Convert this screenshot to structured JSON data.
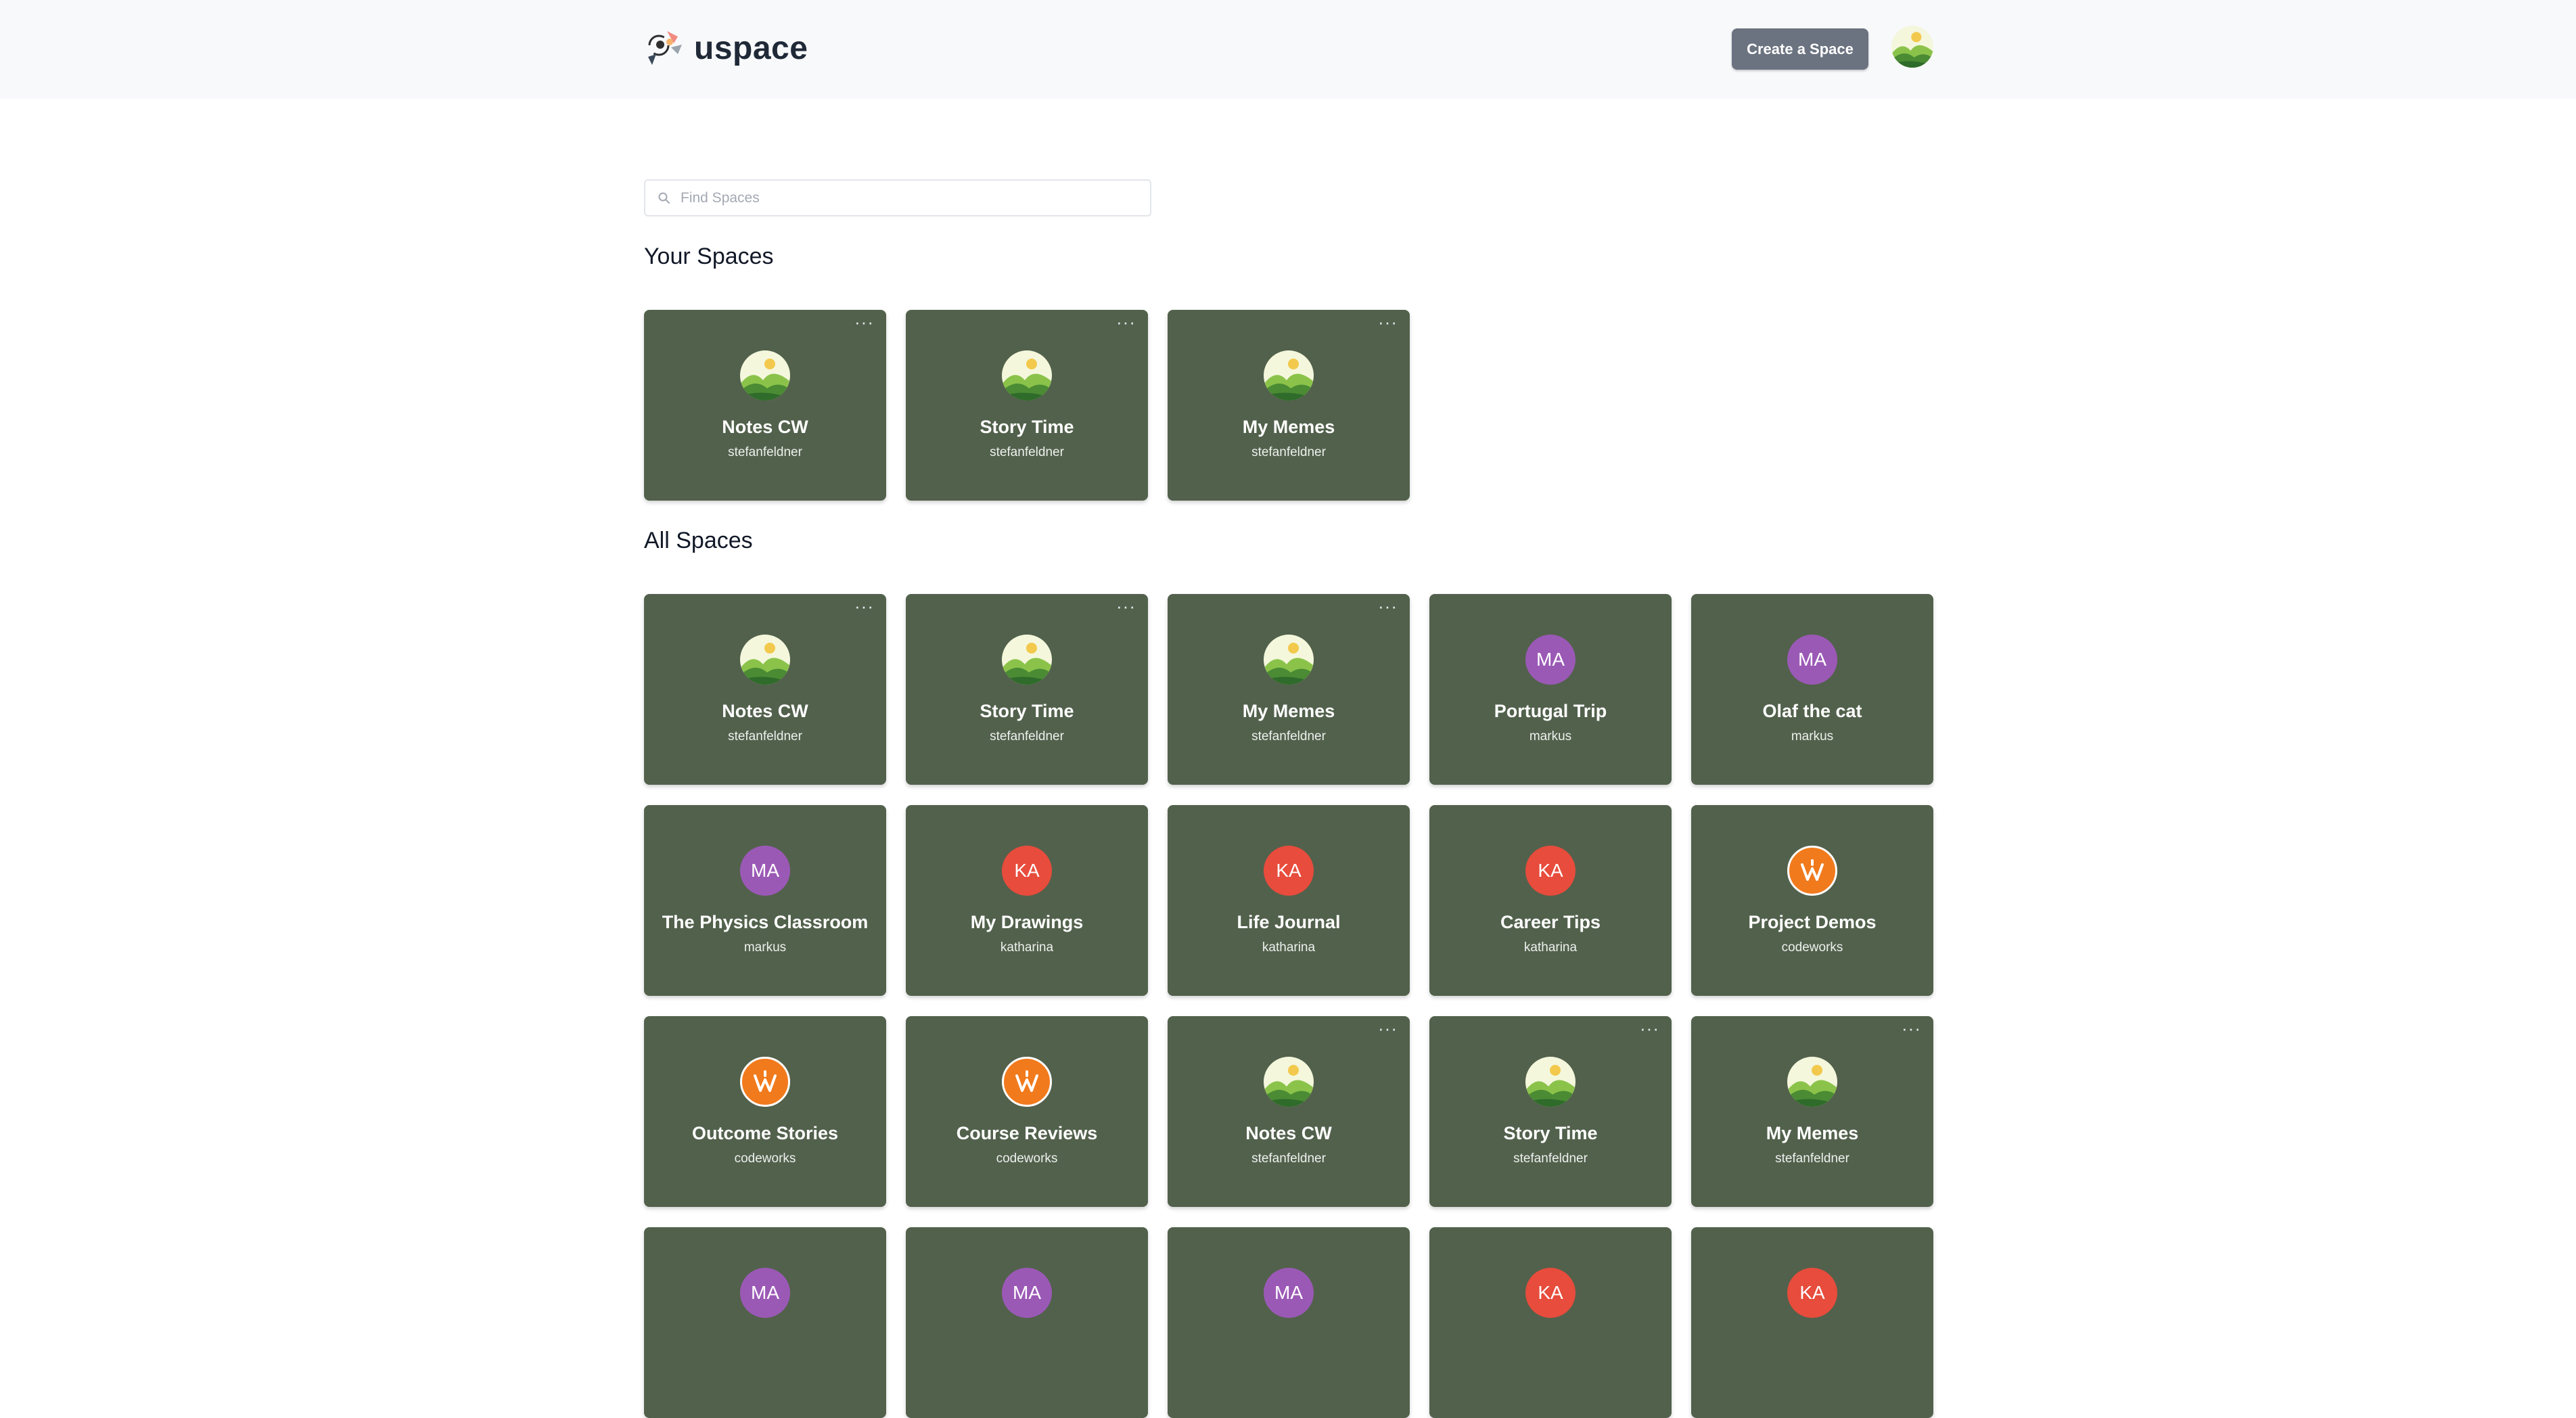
{
  "header": {
    "brand": "uspace",
    "create_label": "Create a Space"
  },
  "search": {
    "placeholder": "Find Spaces",
    "value": ""
  },
  "your_spaces": {
    "title": "Your Spaces",
    "cards": [
      {
        "title": "Notes CW",
        "owner": "stefanfeldner",
        "avatar": "landscape",
        "menu": "···"
      },
      {
        "title": "Story Time",
        "owner": "stefanfeldner",
        "avatar": "landscape",
        "menu": "···"
      },
      {
        "title": "My Memes",
        "owner": "stefanfeldner",
        "avatar": "landscape",
        "menu": "···"
      }
    ]
  },
  "all_spaces": {
    "title": "All Spaces",
    "cards": [
      {
        "title": "Notes CW",
        "owner": "stefanfeldner",
        "avatar": "landscape",
        "menu": "···"
      },
      {
        "title": "Story Time",
        "owner": "stefanfeldner",
        "avatar": "landscape",
        "menu": "···"
      },
      {
        "title": "My Memes",
        "owner": "stefanfeldner",
        "avatar": "landscape",
        "menu": "···"
      },
      {
        "title": "Portugal Trip",
        "owner": "markus",
        "avatar": "initials",
        "initials": "MA"
      },
      {
        "title": "Olaf the cat",
        "owner": "markus",
        "avatar": "initials",
        "initials": "MA"
      },
      {
        "title": "The Physics Classroom",
        "owner": "markus",
        "avatar": "initials",
        "initials": "MA"
      },
      {
        "title": "My Drawings",
        "owner": "katharina",
        "avatar": "initials",
        "initials": "KA"
      },
      {
        "title": "Life Journal",
        "owner": "katharina",
        "avatar": "initials",
        "initials": "KA"
      },
      {
        "title": "Career Tips",
        "owner": "katharina",
        "avatar": "initials",
        "initials": "KA"
      },
      {
        "title": "Project Demos",
        "owner": "codeworks",
        "avatar": "codeworks-logo"
      },
      {
        "title": "Outcome Stories",
        "owner": "codeworks",
        "avatar": "codeworks-logo"
      },
      {
        "title": "Course Reviews",
        "owner": "codeworks",
        "avatar": "codeworks-logo"
      },
      {
        "title": "Notes CW",
        "owner": "stefanfeldner",
        "avatar": "landscape",
        "menu": "···"
      },
      {
        "title": "Story Time",
        "owner": "stefanfeldner",
        "avatar": "landscape",
        "menu": "···"
      },
      {
        "title": "My Memes",
        "owner": "stefanfeldner",
        "avatar": "landscape",
        "menu": "···"
      },
      {
        "title": "",
        "owner": "",
        "avatar": "initials",
        "initials": "MA"
      },
      {
        "title": "",
        "owner": "",
        "avatar": "initials",
        "initials": "MA"
      },
      {
        "title": "",
        "owner": "",
        "avatar": "initials",
        "initials": "MA"
      },
      {
        "title": "",
        "owner": "",
        "avatar": "initials",
        "initials": "KA"
      },
      {
        "title": "",
        "owner": "",
        "avatar": "initials",
        "initials": "KA"
      }
    ]
  },
  "colors": {
    "card_bg": "#52614c",
    "button_bg": "#6b7280",
    "avatar_MA": "#9b59b6",
    "avatar_KA": "#e74c3c",
    "codeworks_orange": "#f17a1c"
  },
  "icons": {
    "search": "magnifier-icon",
    "menu": "more-horizontal-icon",
    "brand": "uspace-logo-icon"
  }
}
